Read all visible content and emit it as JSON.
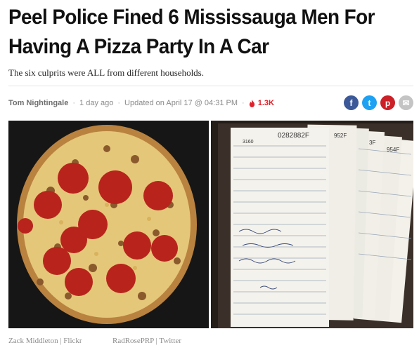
{
  "article": {
    "headline": "Peel Police Fined 6 Mississauga Men For Having A Pizza Party In A Car",
    "subtitle": "The six culprits were ALL from different households."
  },
  "meta": {
    "author": "Tom Nightingale",
    "separator": "·",
    "published": "1 day ago",
    "updated": "Updated on April 17 @ 04:31 PM",
    "views": "1.3K"
  },
  "share": {
    "facebook": "f",
    "twitter": "t",
    "pinterest": "p",
    "email": "✉"
  },
  "images": {
    "left_credit": "Zack Middleton | Flickr",
    "right_credit": "RadRosePRP | Twitter",
    "ticket_number": "0282882F",
    "ticket_prefix": "3160",
    "ticket_side_1": "952F",
    "ticket_side_2": "3F",
    "ticket_side_3": "954F"
  },
  "colors": {
    "views": "#e0202a",
    "facebook": "#3b5998",
    "twitter": "#1da1f2",
    "pinterest": "#cb2027"
  }
}
